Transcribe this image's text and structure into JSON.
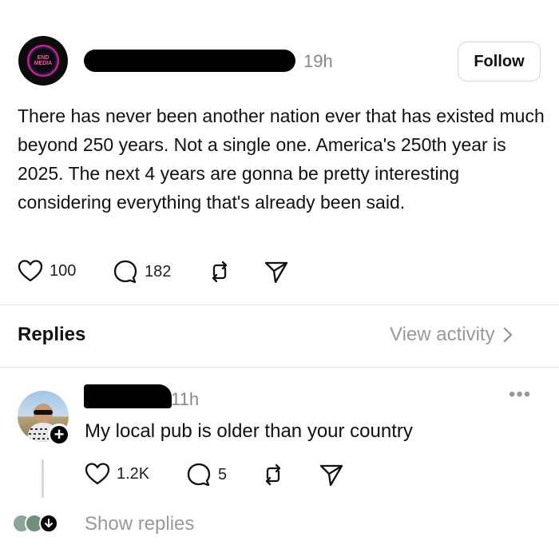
{
  "post": {
    "avatar_text": "END MEDIA",
    "time": "19h",
    "follow_label": "Follow",
    "body": "There has never been another nation ever that has existed much beyond 250 years. Not a single one. America's 250th year is 2025. The next 4 years are gonna be pretty interesting considering everything that's already been said.",
    "likes": "100",
    "comments": "182"
  },
  "replies_section": {
    "title": "Replies",
    "view_activity": "View activity"
  },
  "reply": {
    "time": "11h",
    "text": "My local pub is older than your country",
    "likes": "1.2K",
    "comments": "5",
    "show_replies": "Show replies"
  },
  "icons": {
    "like": "heart-icon",
    "comment": "comment-bubble-icon",
    "repost": "repost-icon",
    "share": "send-icon",
    "more": "more-dots-icon",
    "chevron": "chevron-right-icon",
    "plus": "plus-icon",
    "arrow_down": "arrow-down-icon"
  }
}
